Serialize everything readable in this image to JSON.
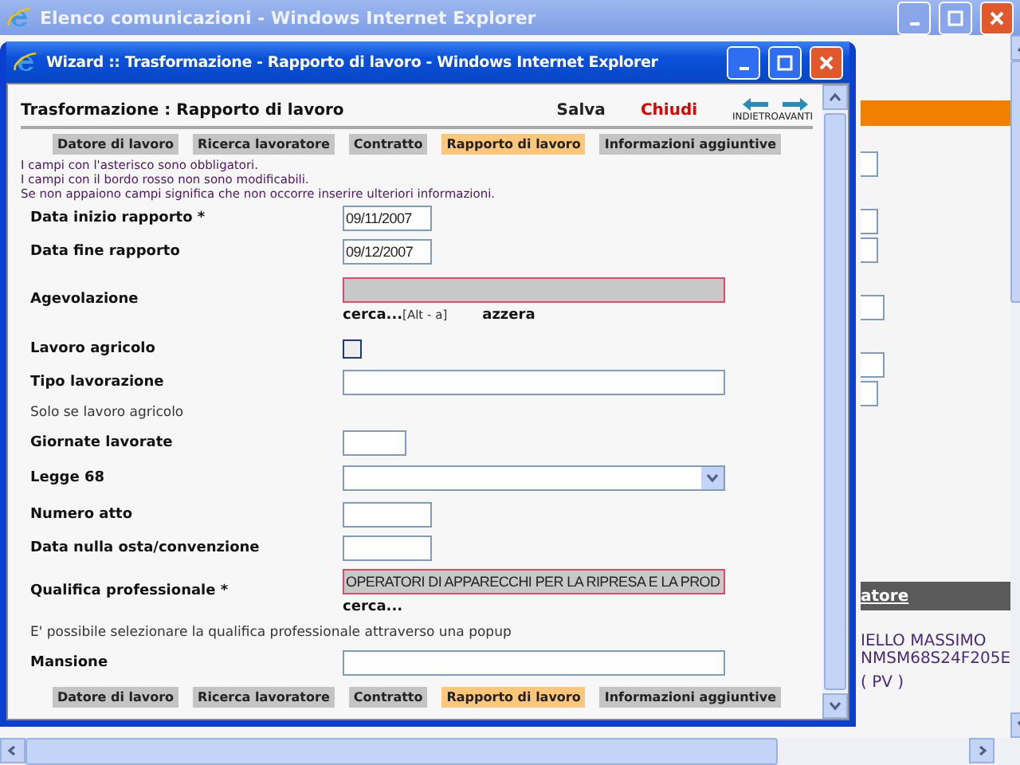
{
  "background_window": {
    "title": "Elenco comunicazioni - Windows Internet Explorer",
    "table_header": "atore",
    "cells": [
      "IELLO MASSIMO",
      "NMSM68S24F205E",
      "( PV )"
    ]
  },
  "wizard_window": {
    "title": "Wizard :: Trasformazione - Rapporto di lavoro - Windows Internet Explorer"
  },
  "page": {
    "heading": "Trasformazione : Rapporto di lavoro",
    "actions": [
      {
        "label": "Salva",
        "kind": "save"
      },
      {
        "label": "Chiudi",
        "kind": "close"
      }
    ],
    "nav": [
      {
        "label": "INDIETRO",
        "kind": "back"
      },
      {
        "label": "AVANTI",
        "kind": "forward"
      }
    ]
  },
  "steps_top": [
    {
      "label": "Datore di lavoro",
      "selected": false
    },
    {
      "label": "Ricerca lavoratore",
      "selected": false
    },
    {
      "label": "Contratto",
      "selected": false
    },
    {
      "label": "Rapporto di lavoro",
      "selected": true
    },
    {
      "label": "Informazioni aggiuntive",
      "selected": false
    }
  ],
  "notes": [
    "I campi con l'asterisco sono obbligatori.",
    "I campi con il bordo rosso non sono modificabili.",
    "Se non appaiono campi significa che non occorre inserire ulteriori informazioni."
  ],
  "fields": [
    {
      "kind": "date",
      "label": "Data inizio rapporto *",
      "value": "09/11/2007"
    },
    {
      "kind": "date",
      "label": "Data fine rapporto",
      "value": "09/12/2007"
    },
    {
      "kind": "lookup",
      "label": "Agevolazione",
      "readonly": true,
      "links": [
        {
          "label": "cerca...",
          "shortcut": "[Alt - a]"
        },
        {
          "label": "azzera"
        }
      ]
    },
    {
      "kind": "checkbox",
      "label": "Lavoro agricolo",
      "checked": false
    },
    {
      "kind": "text",
      "label": "Tipo lavorazione"
    },
    {
      "kind": "note",
      "label": "Solo se lavoro agricolo"
    },
    {
      "kind": "number",
      "label": "Giornate lavorate"
    },
    {
      "kind": "select",
      "label": "Legge 68"
    },
    {
      "kind": "date",
      "label": "Numero atto"
    },
    {
      "kind": "date",
      "label": "Data nulla osta/convenzione"
    },
    {
      "kind": "lookup",
      "label": "Qualifica professionale *",
      "value": "OPERATORI DI APPARECCHI PER LA RIPRESA E LA PROD",
      "readonly": true,
      "links": [
        {
          "label": "cerca..."
        }
      ]
    },
    {
      "kind": "note",
      "label": "E' possibile selezionare la qualifica professionale attraverso una popup"
    },
    {
      "kind": "text",
      "label": "Mansione"
    }
  ],
  "steps_bottom": [
    {
      "label": "Datore di lavoro",
      "selected": false
    },
    {
      "label": "Ricerca lavoratore",
      "selected": false
    },
    {
      "label": "Contratto",
      "selected": false
    },
    {
      "label": "Rapporto di lavoro",
      "selected": true
    },
    {
      "label": "Informazioni aggiuntive",
      "selected": false
    }
  ]
}
